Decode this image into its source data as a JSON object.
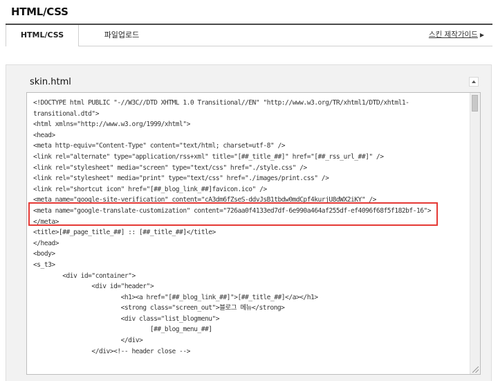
{
  "page": {
    "title": "HTML/CSS"
  },
  "tabs": [
    {
      "label": "HTML/CSS",
      "active": true
    },
    {
      "label": "파일업로드",
      "active": false
    }
  ],
  "guide_link": {
    "label": "스킨 제작가이드",
    "arrow": "▶"
  },
  "editor": {
    "file_name": "skin.html",
    "lines": [
      "<!DOCTYPE html PUBLIC \"-//W3C//DTD XHTML 1.0 Transitional//EN\" \"http://www.w3.org/TR/xhtml1/DTD/xhtml1-",
      "transitional.dtd\">",
      "<html xmlns=\"http://www.w3.org/1999/xhtml\">",
      "<head>",
      "<meta http-equiv=\"Content-Type\" content=\"text/html; charset=utf-8\" />",
      "<link rel=\"alternate\" type=\"application/rss+xml\" title=\"[##_title_##]\" href=\"[##_rss_url_##]\" />",
      "<link rel=\"stylesheet\" media=\"screen\" type=\"text/css\" href=\"./style.css\" />",
      "<link rel=\"stylesheet\" media=\"print\" type=\"text/css\" href=\"./images/print.css\" />",
      "<link rel=\"shortcut icon\" href=\"[##_blog_link_##]favicon.ico\" />",
      "<meta name=\"google-site-verification\" content=\"cA3dm6fZseS-ddvJsB1tbdw0mdCpf4kurjU8dWX2iKY\" />",
      "<meta name=\"google-translate-customization\" content=\"726aa0f4133ed7df-6e990a464af255df-ef4096f68f5f182bf-16\">",
      "</meta>",
      "<title>[##_page_title_##] :: [##_title_##]</title>",
      "</head>",
      "<body>",
      "<s_t3>",
      "        <div id=\"container\">",
      "                <div id=\"header\">",
      "                        <h1><a href=\"[##_blog_link_##]\">[##_title_##]</a></h1>",
      "                        <strong class=\"screen_out\">블로그 메뉴</strong>",
      "                        <div class=\"list_blogmenu\">",
      "                                [##_blog_menu_##]",
      "                        </div>",
      "                </div><!-- header close -->"
    ]
  },
  "colors": {
    "highlight_border": "#e53935",
    "tab_top_border": "#4a4a4a",
    "panel_bg": "#f2f2f2"
  },
  "icons": {
    "collapse": "triangle-up-icon",
    "guide_arrow": "triangle-right-icon",
    "resize": "resize-grip-icon"
  }
}
